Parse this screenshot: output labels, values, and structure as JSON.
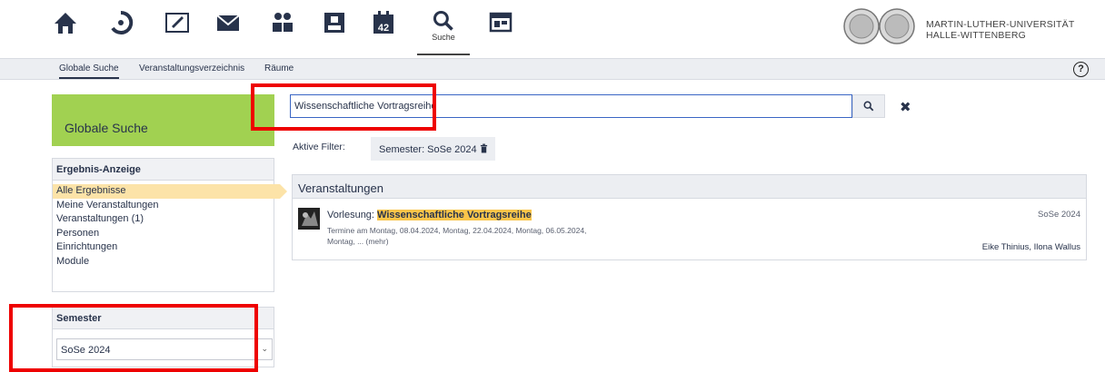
{
  "nav": {
    "search_label": "Suche"
  },
  "university": {
    "line1": "MARTIN-LUTHER-UNIVERSITÄT",
    "line2": "HALLE-WITTENBERG"
  },
  "subnav": {
    "items": [
      "Globale Suche",
      "Veranstaltungsverzeichnis",
      "Räume"
    ],
    "help": "?"
  },
  "sidebar": {
    "heading": "Globale Suche",
    "result_widget": {
      "title": "Ergebnis-Anzeige",
      "items": [
        "Alle Ergebnisse",
        "Meine Veranstaltungen",
        "Veranstaltungen (1)",
        "Personen",
        "Einrichtungen",
        "Module"
      ]
    },
    "semester_widget": {
      "title": "Semester",
      "selected": "SoSe 2024"
    }
  },
  "search": {
    "value": "Wissenschaftliche Vortragsreihe",
    "filter_label": "Aktive Filter:",
    "filter_chip": "Semester: SoSe 2024"
  },
  "results": {
    "section_title": "Veranstaltungen",
    "items": [
      {
        "type_prefix": "Vorlesung: ",
        "title": "Wissenschaftliche Vortragsreihe",
        "desc_line1": "Termine am Montag, 08.04.2024, Montag, 22.04.2024, Montag, 06.05.2024,",
        "desc_line2": "Montag, ... (mehr)",
        "semester": "SoSe 2024",
        "lecturers": "Eike Thinius, Ilona Wallus"
      }
    ]
  },
  "colors": {
    "sidebar_head": "#a1d151",
    "highlight": "#f9c54a",
    "active_item": "#fce3a8",
    "annotation": "#ee0000",
    "search_border": "#3a66c4"
  },
  "icons": [
    "home-icon",
    "dashboard-icon",
    "news-icon",
    "messages-icon",
    "community-icon",
    "profile-icon",
    "calendar-icon",
    "search-icon",
    "schedule-icon"
  ]
}
